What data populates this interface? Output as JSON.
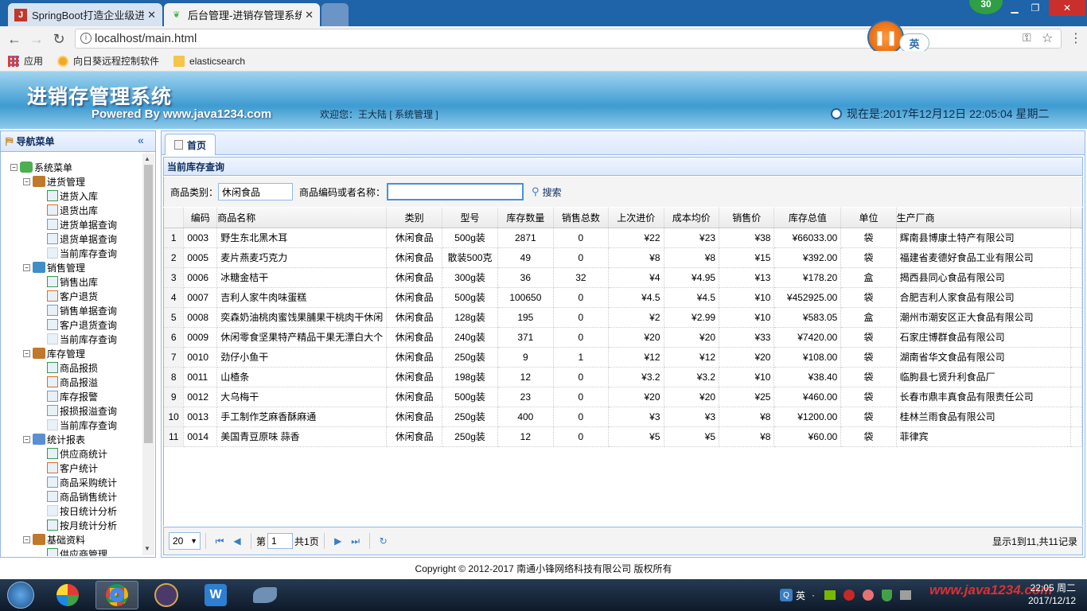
{
  "browser": {
    "tabs": [
      {
        "title": "SpringBoot打造企业级进"
      },
      {
        "title": "后台管理-进销存管理系统"
      }
    ],
    "url": "localhost/main.html",
    "ime": "英",
    "badge": "30",
    "bookmarks": [
      "应用",
      "向日葵远程控制软件",
      "elasticsearch"
    ]
  },
  "header": {
    "title": "进销存管理系统",
    "powered": "Powered By www.java1234.com",
    "welcome": "欢迎您：王大陆 [ 系统管理 ]",
    "clock": "现在是:2017年12月12日 22:05:04 星期二"
  },
  "sidebar": {
    "title": "导航菜单",
    "root": "系统菜单",
    "groups": [
      {
        "label": "进货管理",
        "items": [
          "进货入库",
          "退货出库",
          "进货单据查询",
          "退货单据查询",
          "当前库存查询"
        ]
      },
      {
        "label": "销售管理",
        "items": [
          "销售出库",
          "客户退货",
          "销售单据查询",
          "客户退货查询",
          "当前库存查询"
        ]
      },
      {
        "label": "库存管理",
        "items": [
          "商品报损",
          "商品报溢",
          "库存报警",
          "报损报溢查询",
          "当前库存查询"
        ]
      },
      {
        "label": "统计报表",
        "items": [
          "供应商统计",
          "客户统计",
          "商品采购统计",
          "商品销售统计",
          "按日统计分析",
          "按月统计分析"
        ]
      },
      {
        "label": "基础资料",
        "items": [
          "供应商管理"
        ]
      }
    ]
  },
  "main": {
    "tab": "首页",
    "panel_title": "当前库存查询",
    "filter": {
      "category_label": "商品类别：",
      "category_value": "休闲食品",
      "name_label": "商品编码或者名称：",
      "name_value": "",
      "search_label": "搜索"
    },
    "columns": [
      "编码",
      "商品名称",
      "类别",
      "型号",
      "库存数量",
      "销售总数",
      "上次进价",
      "成本均价",
      "销售价",
      "库存总值",
      "单位",
      "生产厂商"
    ],
    "rows": [
      [
        "1",
        "0003",
        "野生东北黑木耳",
        "休闲食品",
        "500g装",
        "2871",
        "0",
        "¥22",
        "¥23",
        "¥38",
        "¥66033.00",
        "袋",
        "辉南县博康土特产有限公司"
      ],
      [
        "2",
        "0005",
        "麦片燕麦巧克力",
        "休闲食品",
        "散装500克",
        "49",
        "0",
        "¥8",
        "¥8",
        "¥15",
        "¥392.00",
        "袋",
        "福建省麦德好食品工业有限公司"
      ],
      [
        "3",
        "0006",
        "冰糖金桔干",
        "休闲食品",
        "300g装",
        "36",
        "32",
        "¥4",
        "¥4.95",
        "¥13",
        "¥178.20",
        "盒",
        "揭西县同心食品有限公司"
      ],
      [
        "4",
        "0007",
        "吉利人家牛肉味蛋糕",
        "休闲食品",
        "500g装",
        "100650",
        "0",
        "¥4.5",
        "¥4.5",
        "¥10",
        "¥452925.00",
        "袋",
        "合肥吉利人家食品有限公司"
      ],
      [
        "5",
        "0008",
        "奕森奶油桃肉蜜饯果脯果干桃肉干休闲",
        "休闲食品",
        "128g装",
        "195",
        "0",
        "¥2",
        "¥2.99",
        "¥10",
        "¥583.05",
        "盒",
        "潮州市潮安区正大食品有限公司"
      ],
      [
        "6",
        "0009",
        "休闲零食坚果特产精品干果无漂白大个",
        "休闲食品",
        "240g装",
        "371",
        "0",
        "¥20",
        "¥20",
        "¥33",
        "¥7420.00",
        "袋",
        "石家庄博群食品有限公司"
      ],
      [
        "7",
        "0010",
        "劲仔小鱼干",
        "休闲食品",
        "250g装",
        "9",
        "1",
        "¥12",
        "¥12",
        "¥20",
        "¥108.00",
        "袋",
        "湖南省华文食品有限公司"
      ],
      [
        "8",
        "0011",
        "山楂条",
        "休闲食品",
        "198g装",
        "12",
        "0",
        "¥3.2",
        "¥3.2",
        "¥10",
        "¥38.40",
        "袋",
        "临朐县七贤升利食品厂"
      ],
      [
        "9",
        "0012",
        "大乌梅干",
        "休闲食品",
        "500g装",
        "23",
        "0",
        "¥20",
        "¥20",
        "¥25",
        "¥460.00",
        "袋",
        "长春市鼎丰真食品有限责任公司"
      ],
      [
        "10",
        "0013",
        "手工制作芝麻香酥麻通",
        "休闲食品",
        "250g装",
        "400",
        "0",
        "¥3",
        "¥3",
        "¥8",
        "¥1200.00",
        "袋",
        "桂林兰雨食品有限公司"
      ],
      [
        "11",
        "0014",
        "美国青豆原味 蒜香",
        "休闲食品",
        "250g装",
        "12",
        "0",
        "¥5",
        "¥5",
        "¥8",
        "¥60.00",
        "袋",
        "菲律宾"
      ]
    ],
    "pager": {
      "page_size": "20",
      "page_prefix": "第",
      "page_value": "1",
      "page_total": "共1页",
      "summary": "显示1到11,共11记录"
    }
  },
  "footer": "Copyright © 2012-2017 南通小锋网络科技有限公司 版权所有",
  "taskbar": {
    "ime": "英",
    "watermark": "www.java1234.com",
    "time": "22:05 周二",
    "date": "2017/12/12"
  }
}
